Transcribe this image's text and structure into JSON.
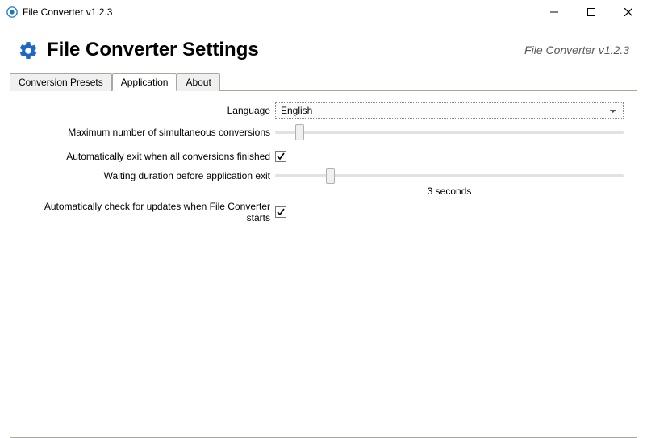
{
  "titlebar": {
    "title": "File Converter v1.2.3"
  },
  "header": {
    "heading": "File Converter Settings",
    "version": "File Converter v1.2.3"
  },
  "tabs": {
    "presets": "Conversion Presets",
    "application": "Application",
    "about": "About"
  },
  "form": {
    "language_label": "Language",
    "language_value": "English",
    "max_sim_label": "Maximum number of simultaneous conversions",
    "auto_exit_label": "Automatically exit when all conversions finished",
    "wait_label": "Waiting duration before application exit",
    "wait_value": "3 seconds",
    "auto_update_label": "Automatically check for updates when File Converter starts"
  }
}
